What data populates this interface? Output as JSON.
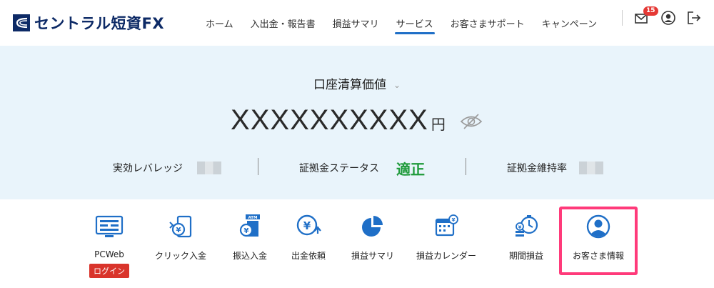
{
  "brand": {
    "name": "セントラル短資FX",
    "color": "#0d2a66"
  },
  "nav": {
    "items": [
      {
        "label": "ホーム"
      },
      {
        "label": "入出金・報告書"
      },
      {
        "label": "損益サマリ"
      },
      {
        "label": "サービス"
      },
      {
        "label": "お客さまサポート"
      },
      {
        "label": "キャンペーン"
      }
    ],
    "active": "サービス",
    "accent": "#1f6fc7",
    "notification_count": "15",
    "icons": [
      "mail-icon",
      "account-icon",
      "logout-icon"
    ]
  },
  "balance": {
    "title": "口座清算価値",
    "amount": "XXXXXXXXXX",
    "unit": "円",
    "background": "#e9f4fb"
  },
  "stats": {
    "leverage_label": "実効レバレッジ",
    "status_label": "証拠金ステータス",
    "status_value": "適正",
    "status_color": "#1e9a3a",
    "ratio_label": "証拠金維持率"
  },
  "menu": {
    "items": [
      {
        "label": "PCWeb",
        "badge": "ログイン",
        "icon": "pc-web-icon"
      },
      {
        "label": "クリック入金",
        "icon": "click-deposit-icon"
      },
      {
        "label": "振込入金",
        "icon": "atm-transfer-icon"
      },
      {
        "label": "出金依頼",
        "icon": "withdrawal-icon"
      },
      {
        "label": "損益サマリ",
        "icon": "pie-chart-icon"
      },
      {
        "label": "損益カレンダー",
        "icon": "calendar-icon"
      },
      {
        "label": "期間損益",
        "icon": "period-pl-icon"
      },
      {
        "label": "お客さま情報",
        "icon": "customer-info-icon"
      }
    ],
    "highlight_color": "#ff3a7a",
    "icon_color": "#1f6fc7"
  }
}
